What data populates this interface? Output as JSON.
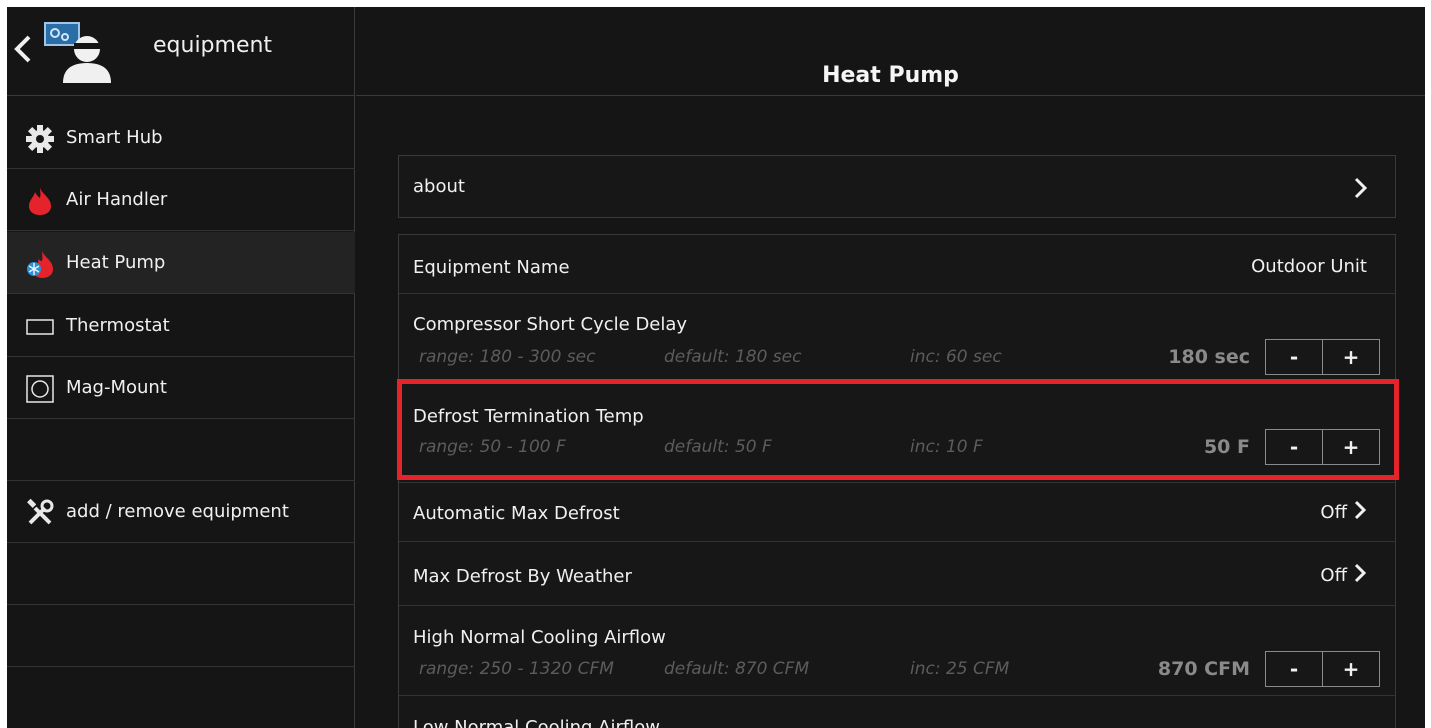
{
  "sidebar": {
    "title": "equipment",
    "items": [
      {
        "label": "Smart Hub",
        "icon": "gear-icon"
      },
      {
        "label": "Air Handler",
        "icon": "flame-icon"
      },
      {
        "label": "Heat Pump",
        "icon": "heat-pump-icon",
        "active": true
      },
      {
        "label": "Thermostat",
        "icon": "thermostat-icon"
      },
      {
        "label": "Mag-Mount",
        "icon": "mag-mount-icon"
      }
    ],
    "add_remove_label": "add / remove equipment"
  },
  "header": {
    "title": "Heat Pump"
  },
  "about": {
    "label": "about"
  },
  "settings": {
    "equipment_name": {
      "label": "Equipment Name",
      "value": "Outdoor Unit"
    },
    "compressor_delay": {
      "label": "Compressor Short Cycle Delay",
      "range": "range: 180 - 300 sec",
      "default": "default: 180 sec",
      "inc": "inc: 60 sec",
      "value": "180 sec"
    },
    "defrost_temp": {
      "label": "Defrost Termination Temp",
      "range": "range: 50 - 100 F",
      "default": "default: 50 F",
      "inc": "inc: 10 F",
      "value": "50 F"
    },
    "auto_max_defrost": {
      "label": "Automatic Max Defrost",
      "value": "Off"
    },
    "max_defrost_weather": {
      "label": "Max Defrost By Weather",
      "value": "Off"
    },
    "high_cooling_airflow": {
      "label": "High Normal Cooling Airflow",
      "range": "range: 250 - 1320 CFM",
      "default": "default: 870 CFM",
      "inc": "inc: 25 CFM",
      "value": "870 CFM"
    },
    "low_cooling_airflow": {
      "label": "Low Normal Cooling Airflow"
    }
  },
  "stepper": {
    "minus": "-",
    "plus": "+"
  },
  "colors": {
    "background": "#151515",
    "highlight": "#e4232b",
    "meta_text": "#5c5c5c",
    "value_text": "#8a8a8a"
  }
}
